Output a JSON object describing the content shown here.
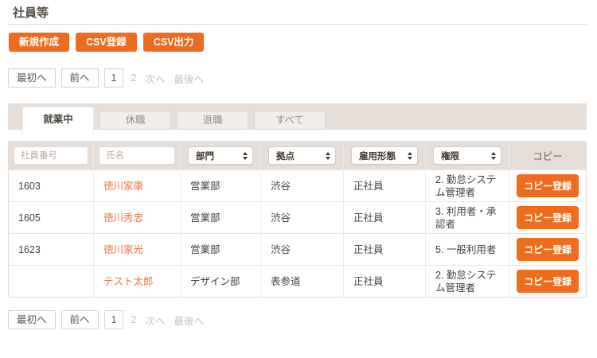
{
  "page": {
    "title": "社員等"
  },
  "toolbar": {
    "buttons": [
      {
        "label": "新規作成"
      },
      {
        "label": "CSV登録"
      },
      {
        "label": "CSV出力"
      }
    ]
  },
  "pagination": {
    "first": "最初へ",
    "prev": "前へ",
    "current_page": "1",
    "page_2": "2",
    "next": "次へ",
    "last": "最後へ"
  },
  "tabs": [
    {
      "label": "就業中",
      "active": true
    },
    {
      "label": "休職",
      "active": false
    },
    {
      "label": "退職",
      "active": false
    },
    {
      "label": "すべて",
      "active": false
    }
  ],
  "table": {
    "filters": {
      "employee_no_placeholder": "社員番号",
      "name_placeholder": "氏名",
      "department": "部門",
      "location": "拠点",
      "employment_type": "雇用形態",
      "permission": "権限",
      "copy_header": "コピー"
    },
    "copy_button_label": "コピー登録",
    "rows": [
      {
        "employee_no": "1603",
        "name": "徳川家康",
        "department": "営業部",
        "location": "渋谷",
        "employment_type": "正社員",
        "permission": "2. 勤怠システム管理者"
      },
      {
        "employee_no": "1605",
        "name": "徳川秀忠",
        "department": "営業部",
        "location": "渋谷",
        "employment_type": "正社員",
        "permission": "3. 利用者・承認者"
      },
      {
        "employee_no": "1623",
        "name": "徳川家光",
        "department": "営業部",
        "location": "渋谷",
        "employment_type": "正社員",
        "permission": "5. 一般利用者"
      },
      {
        "employee_no": "",
        "name": "テスト太郎",
        "department": "デザイン部",
        "location": "表参道",
        "employment_type": "正社員",
        "permission": "2. 勤怠システム管理者"
      }
    ]
  },
  "colors": {
    "accent_orange": "#ed6c1e",
    "link_orange": "#ee7340",
    "header_beige": "#e6ded9"
  }
}
